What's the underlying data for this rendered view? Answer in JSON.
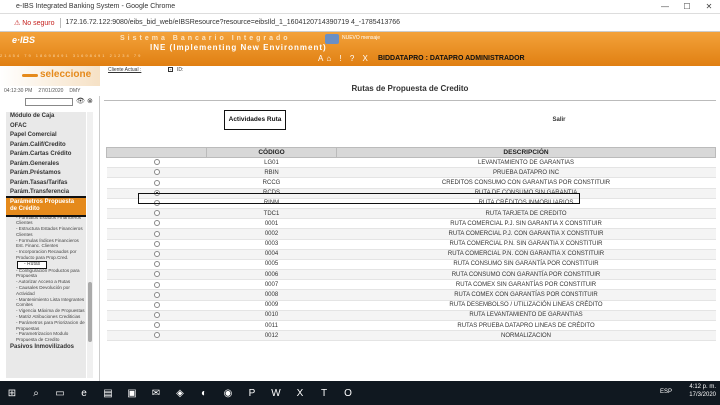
{
  "window": {
    "title": "e-IBS Integrated Banking System - Google Chrome",
    "minimize": "—",
    "maximize": "☐",
    "close": "✕"
  },
  "address": {
    "warning": "⚠ No seguro",
    "url": "172.16.72.122:9080/eibs_bid_web/eIBSResource?resource=eibsIld_1_1604120714390719 4_-1785413766"
  },
  "banner": {
    "logo": "e·IBS",
    "spaced": "Sistema Bancario Integrado",
    "env": "INE (Implementing New Environment)",
    "new_message": "NUEVO mensaje",
    "icons": "A⌂ ! ? X",
    "user": "BIDDATAPRO : DATAPRO ADMINISTRADOR",
    "strip": "21454 79   18698491   31698491   21234 79"
  },
  "left": {
    "selecione": "seleccione",
    "time": "04:12:30 PM",
    "date": "27/01/2020",
    "date_format": "DMY",
    "menu": [
      {
        "label": "Módulo de Caja",
        "type": "item"
      },
      {
        "label": "OFAC",
        "type": "item"
      },
      {
        "label": "Papel Comercial",
        "type": "item"
      },
      {
        "label": "Parám.Calif/Credito",
        "type": "item"
      },
      {
        "label": "Parám.Cartas Crédito",
        "type": "item"
      },
      {
        "label": "Parám.Generales",
        "type": "item"
      },
      {
        "label": "Parám.Préstamos",
        "type": "item"
      },
      {
        "label": "Parám.Tasas/Tarifas",
        "type": "item"
      },
      {
        "label": "Parám.Transferencia",
        "type": "item"
      },
      {
        "label": "Parámetros Propuesta de Crédito",
        "type": "selected"
      },
      {
        "label": "- Formatos Estados Financieros Clientes",
        "type": "sub"
      },
      {
        "label": "- Estructura Estados Financieros Clientes",
        "type": "sub"
      },
      {
        "label": "- Formulas Índices Financieros Est. Financ. Clientes",
        "type": "sub"
      },
      {
        "label": "- Incorporacion Recaudos por Producto para Prop.Cred.",
        "type": "sub"
      },
      {
        "label": "- Rutas",
        "type": "highlight"
      },
      {
        "label": "- Configuración Productos para Propuesta",
        "type": "sub"
      },
      {
        "label": "- Autorizar Acceso a Rutas",
        "type": "sub"
      },
      {
        "label": "- Causales Devolución por Actividad",
        "type": "sub"
      },
      {
        "label": "- Mantenimiento Lista Integrantes Comites",
        "type": "sub"
      },
      {
        "label": "- Vigencia Máxima de Propuestas",
        "type": "sub"
      },
      {
        "label": "- Matriz Atribuciones Crediticias",
        "type": "sub"
      },
      {
        "label": "- Parámetros para Priorizacion de Propuestas",
        "type": "sub"
      },
      {
        "label": "- Parametrizacion Modulo Propuesta de Credito",
        "type": "sub"
      },
      {
        "label": "Pasivos Inmovilizados",
        "type": "item"
      }
    ]
  },
  "tabs": {
    "cliente_actual": "Cliente Actual :",
    "id_label": "ID:"
  },
  "main": {
    "title": "Rutas de Propuesta de Credito",
    "btn_actividades": "Actividades Ruta",
    "btn_salir": "Salir",
    "col_codigo": "CÓDIGO",
    "col_descripcion": "DESCRIPCIÓN",
    "rows": [
      {
        "code": "LG01",
        "desc": "LEVANTAMIENTO DE GARANTIAS"
      },
      {
        "code": "RBIN",
        "desc": "PRUEBA DATAPRO INC"
      },
      {
        "code": "RCCG",
        "desc": "CREDITOS CONSUMO CON GARANTIAS POR CONSTITUIR"
      },
      {
        "code": "RCDS",
        "desc": "RUTA DE CONSUMO SIN GARANTIA"
      },
      {
        "code": "RINM",
        "desc": "RUTA CRÉDITOS INMOBILIARIOS"
      },
      {
        "code": "TDC1",
        "desc": "RUTA TARJETA DE CREDITO"
      },
      {
        "code": "0001",
        "desc": "RUTA COMERCIAL P.J. SIN GARANTIA X CONSTITUIR"
      },
      {
        "code": "0002",
        "desc": "RUTA COMERCIAL P.J. CON GARANTIA X CONSTITUIR"
      },
      {
        "code": "0003",
        "desc": "RUTA COMERCIAL P.N. SIN GARANTIA X CONSTITUIR"
      },
      {
        "code": "0004",
        "desc": "RUTA COMERCIAL P.N. CON GARANTIA X CONSTITUIR"
      },
      {
        "code": "0005",
        "desc": "RUTA CONSUMO SIN GARANTÍA POR CONSTITUIR"
      },
      {
        "code": "0006",
        "desc": "RUTA CONSUMO CON GARANTÍA POR CONSTITUIR"
      },
      {
        "code": "0007",
        "desc": "RUTA COMEX SIN GARANTÍAS POR CONSTITUIR"
      },
      {
        "code": "0008",
        "desc": "RUTA COMEX CON GARANTÍAS POR CONSTITUIR"
      },
      {
        "code": "0009",
        "desc": "RUTA DESEMBOLSO / UTILIZACIÓN LINEAS CRÉDITO"
      },
      {
        "code": "0010",
        "desc": "RUTA LEVANTAMIENTO DE GARANTIAS"
      },
      {
        "code": "0011",
        "desc": "RUTAS PRUEBA DATAPRO LINEAS DE CRÉDITO"
      },
      {
        "code": "0012",
        "desc": "NORMALIZACION"
      }
    ],
    "selected_index": 3
  },
  "taskbar": {
    "time": "4:12 p. m.",
    "date": "17/3/2020",
    "lang": "ESP"
  }
}
